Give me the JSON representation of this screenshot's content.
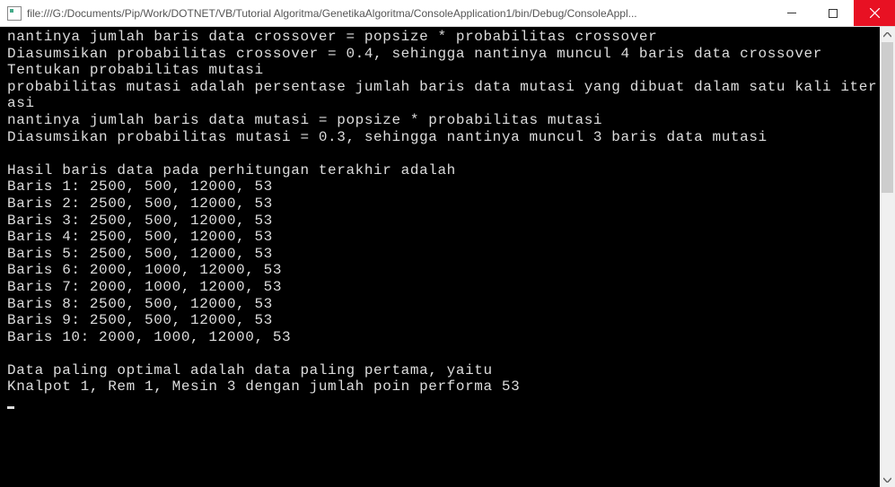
{
  "window": {
    "title": "file:///G:/Documents/Pip/Work/DOTNET/VB/Tutorial Algoritma/GenetikaAlgoritma/ConsoleApplication1/bin/Debug/ConsoleAppl..."
  },
  "console": {
    "lines": [
      "nantinya jumlah baris data crossover = popsize * probabilitas crossover",
      "Diasumsikan probabilitas crossover = 0.4, sehingga nantinya muncul 4 baris data crossover",
      "Tentukan probabilitas mutasi",
      "probabilitas mutasi adalah persentase jumlah baris data mutasi yang dibuat dalam satu kali iterasi",
      "nantinya jumlah baris data mutasi = popsize * probabilitas mutasi",
      "Diasumsikan probabilitas mutasi = 0.3, sehingga nantinya muncul 3 baris data mutasi",
      "",
      "Hasil baris data pada perhitungan terakhir adalah",
      "Baris 1: 2500, 500, 12000, 53",
      "Baris 2: 2500, 500, 12000, 53",
      "Baris 3: 2500, 500, 12000, 53",
      "Baris 4: 2500, 500, 12000, 53",
      "Baris 5: 2500, 500, 12000, 53",
      "Baris 6: 2000, 1000, 12000, 53",
      "Baris 7: 2000, 1000, 12000, 53",
      "Baris 8: 2500, 500, 12000, 53",
      "Baris 9: 2500, 500, 12000, 53",
      "Baris 10: 2000, 1000, 12000, 53",
      "",
      "Data paling optimal adalah data paling pertama, yaitu",
      "Knalpot 1, Rem 1, Mesin 3 dengan jumlah poin performa 53"
    ]
  },
  "scrollbar": {
    "thumb_top_pct": 0,
    "thumb_height_pct": 35
  }
}
